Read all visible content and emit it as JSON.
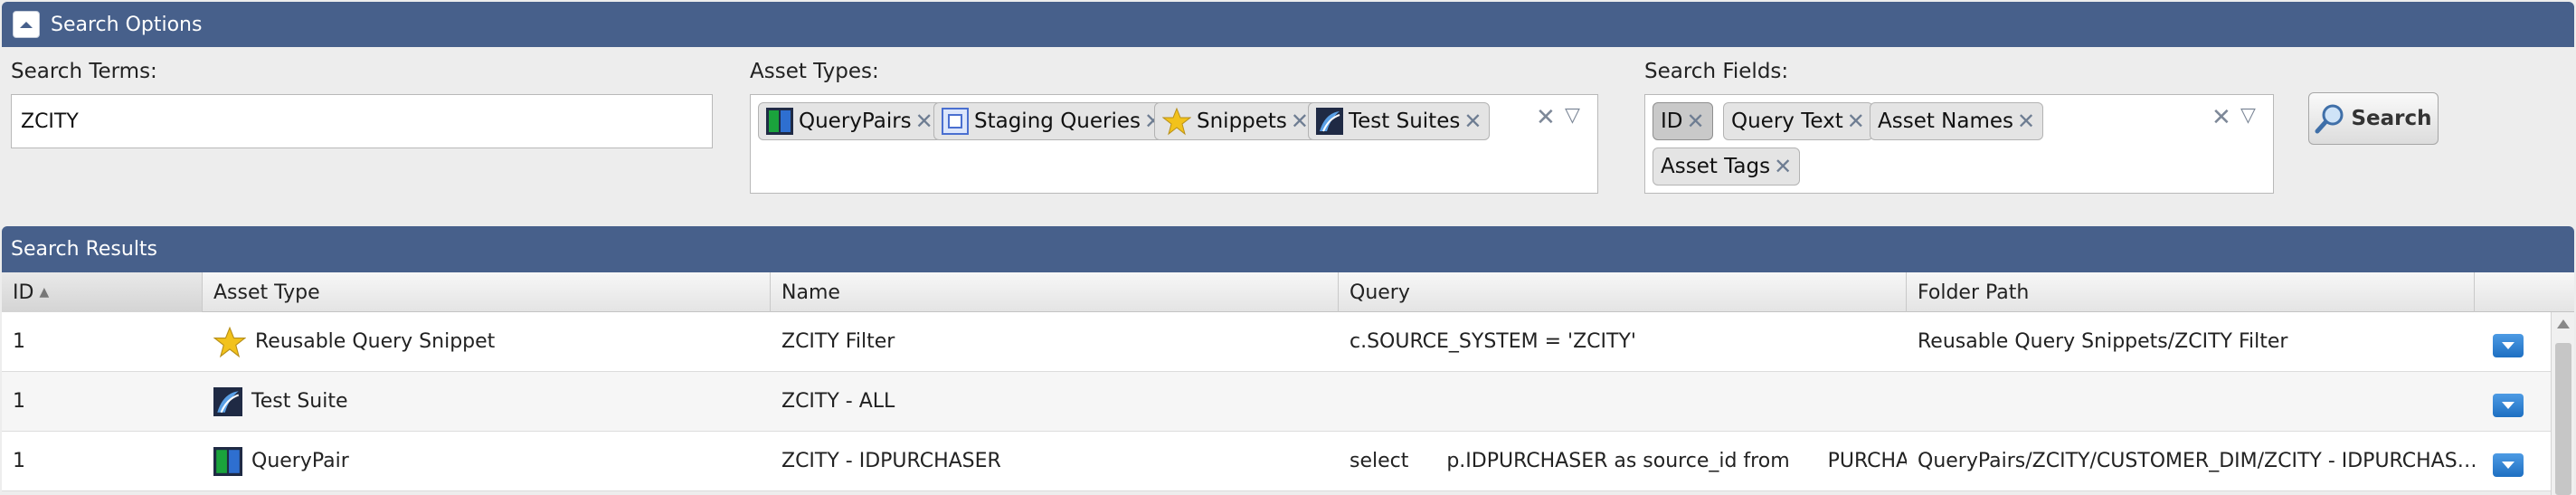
{
  "search_panel": {
    "title": "Search Options"
  },
  "search_terms": {
    "label": "Search Terms:",
    "value": "ZCITY"
  },
  "asset_types": {
    "label": "Asset Types:",
    "tags": [
      {
        "label": "QueryPairs",
        "icon": "querypair-icon"
      },
      {
        "label": "Staging Queries",
        "icon": "staging-query-icon"
      },
      {
        "label": "Snippets",
        "icon": "star-icon"
      },
      {
        "label": "Test Suites",
        "icon": "test-suite-icon"
      }
    ]
  },
  "search_fields": {
    "label": "Search Fields:",
    "tags": [
      {
        "label": "ID"
      },
      {
        "label": "Query Text"
      },
      {
        "label": "Asset Names"
      },
      {
        "label": "Asset Tags"
      }
    ]
  },
  "search_button": {
    "label": "Search"
  },
  "results_panel": {
    "title": "Search Results"
  },
  "columns": [
    "ID",
    "Asset Type",
    "Name",
    "Query",
    "Folder Path"
  ],
  "rows": [
    {
      "id": "1",
      "asset_type": "Reusable Query Snippet",
      "icon": "star-icon",
      "name": "ZCITY Filter",
      "query": "c.SOURCE_SYSTEM = 'ZCITY'",
      "folder": "Reusable Query Snippets/ZCITY Filter"
    },
    {
      "id": "1",
      "asset_type": "Test Suite",
      "icon": "test-suite-icon",
      "name": "ZCITY - ALL",
      "query": "",
      "folder": ""
    },
    {
      "id": "1",
      "asset_type": "QueryPair",
      "icon": "querypair-icon",
      "name": "ZCITY - IDPURCHASER",
      "query": "select      p.IDPURCHASER as source_id from      PURCHA…",
      "folder": "QueryPairs/ZCITY/CUSTOMER_DIM/ZCITY - IDPURCHAS…"
    }
  ],
  "colors": {
    "header_blue": "#47608b",
    "accent_blue": "#1e6fc2",
    "star": "#f2c21b"
  }
}
